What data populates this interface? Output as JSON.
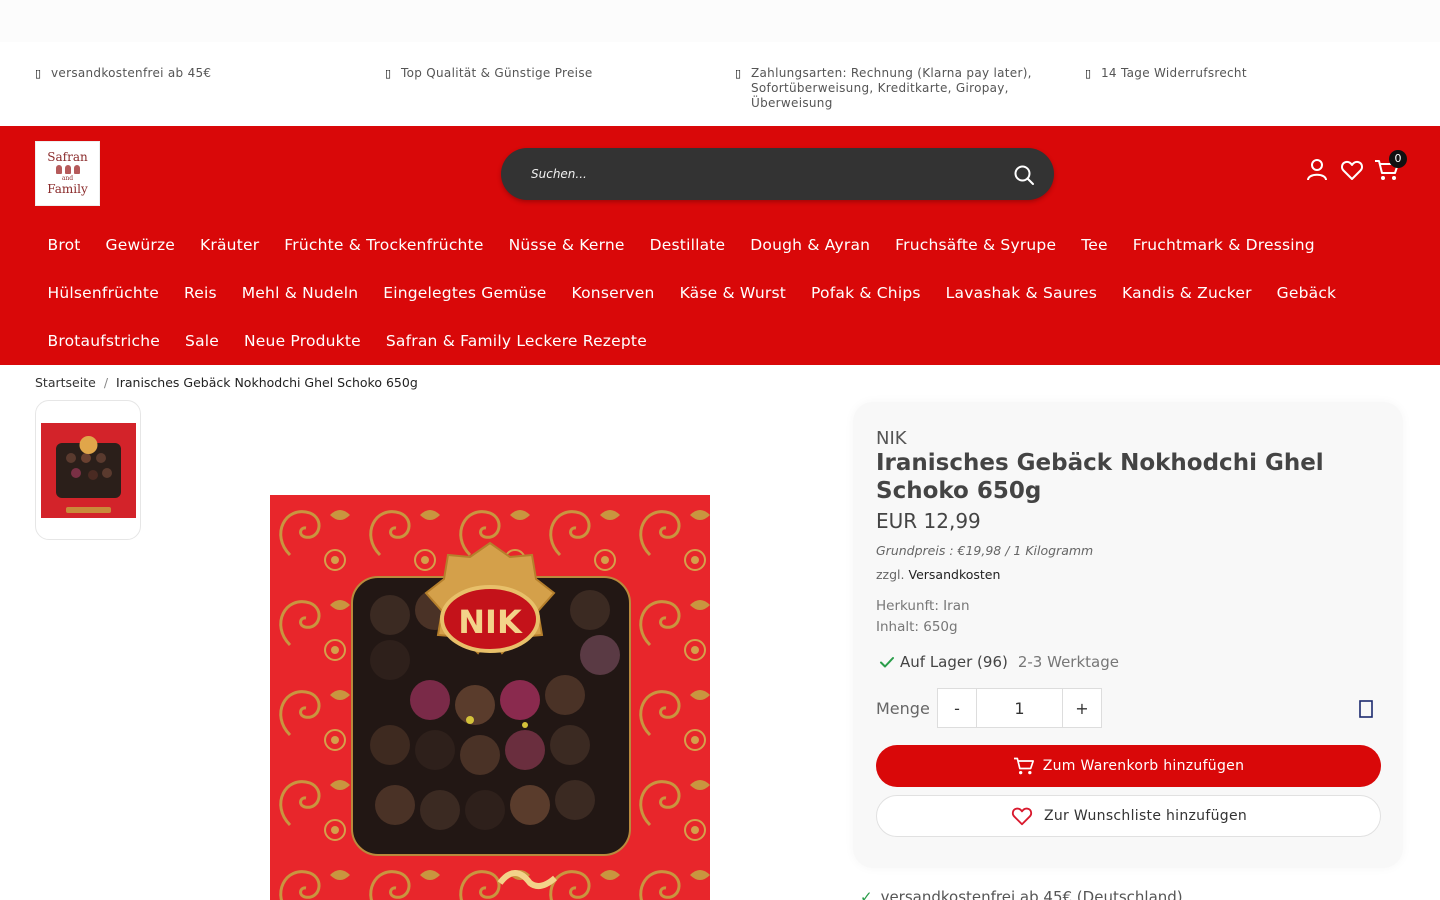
{
  "usps": [
    {
      "icon": "check-icon",
      "text": "versandkostenfrei ab 45€"
    },
    {
      "icon": "check-icon",
      "text": "Top Qualität & Günstige Preise"
    },
    {
      "icon": "check-icon",
      "text": "Zahlungsarten: Rechnung (Klarna pay later), Sofortüberweisung, Kreditkarte, Giropay, Überweisung"
    },
    {
      "icon": "check-icon",
      "text": "14 Tage Widerrufsrecht"
    }
  ],
  "logo": {
    "line1": "Safran",
    "line2": "and",
    "line3": "Family"
  },
  "search": {
    "placeholder": "Suchen..."
  },
  "cart": {
    "count": "0"
  },
  "nav": {
    "row1": [
      "Brot",
      "Gewürze",
      "Kräuter",
      "Früchte & Trockenfrüchte",
      "Nüsse & Kerne",
      "Destillate",
      "Dough & Ayran",
      "Fruchsäfte & Syrupe",
      "Tee",
      "Fruchtmark & Dressing"
    ],
    "row2": [
      "Hülsenfrüchte",
      "Reis",
      "Mehl & Nudeln",
      "Eingelegtes Gemüse",
      "Konserven",
      "Käse & Wurst",
      "Pofak & Chips",
      "Lavashak & Saures",
      "Kandis & Zucker",
      "Gebäck"
    ],
    "row3": [
      "Brotaufstriche",
      "Sale",
      "Neue Produkte",
      "Safran & Family Leckere Rezepte"
    ]
  },
  "breadcrumb": {
    "home": "Startseite",
    "sep": "/",
    "current": "Iranisches Gebäck Nokhodchi Ghel Schoko 650g"
  },
  "product": {
    "brand": "NIK",
    "title": "Iranisches Gebäck Nokhodchi Ghel Schoko 650g",
    "price": "EUR 12,99",
    "base_price": "Grundpreis : €19,98 / 1 Kilogramm",
    "shipping_prefix": "zzgl.",
    "shipping_link": "Versandkosten",
    "origin": "Herkunft: Iran",
    "content": "Inhalt: 650g",
    "stock": "Auf Lager (96)",
    "delivery": "2-3 Werktage",
    "qty_label": "Menge",
    "qty_value": "1",
    "minus": "-",
    "plus": "+",
    "add_to_cart": "Zum Warenkorb hinzufügen",
    "add_to_wishlist": "Zur Wunschliste hinzufügen",
    "box_brand": "NIK"
  },
  "bottom_usp": "versandkostenfrei ab 45€ (Deutschland)",
  "colors": {
    "brand_red": "#d90809",
    "search_bg": "#333333",
    "stock_green": "#2a9d4a"
  }
}
